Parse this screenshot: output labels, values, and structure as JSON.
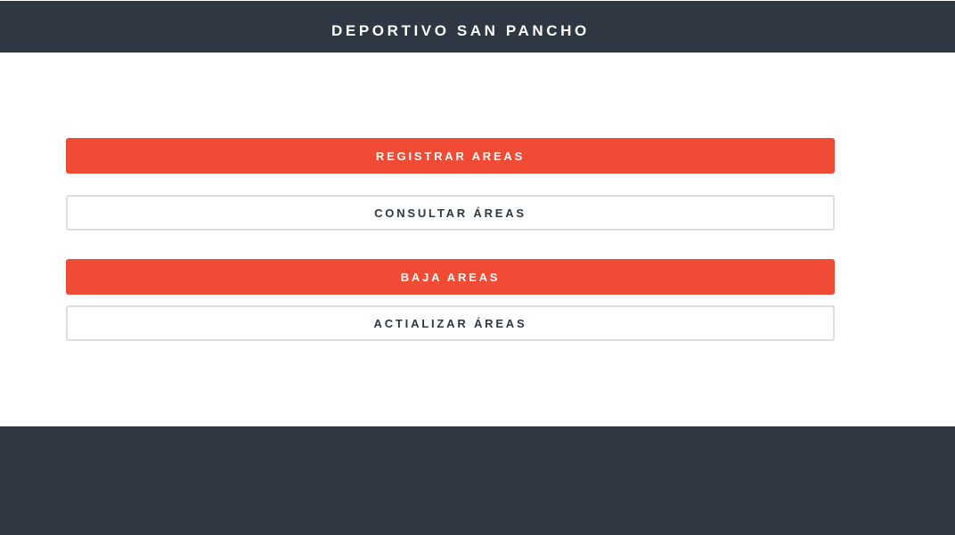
{
  "header": {
    "title": "DEPORTIVO SAN PANCHO"
  },
  "menu": {
    "registrar_label": "REGISTRAR AREAS",
    "consultar_label": "CONSULTAR ÁREAS",
    "baja_label": "BAJA AREAS",
    "actualizar_label": "ACTIALIZAR ÁREAS"
  },
  "colors": {
    "navbar": "#2e3742",
    "accent": "#ef4b35",
    "outline_border": "#dddddd",
    "background": "#ffffff"
  }
}
